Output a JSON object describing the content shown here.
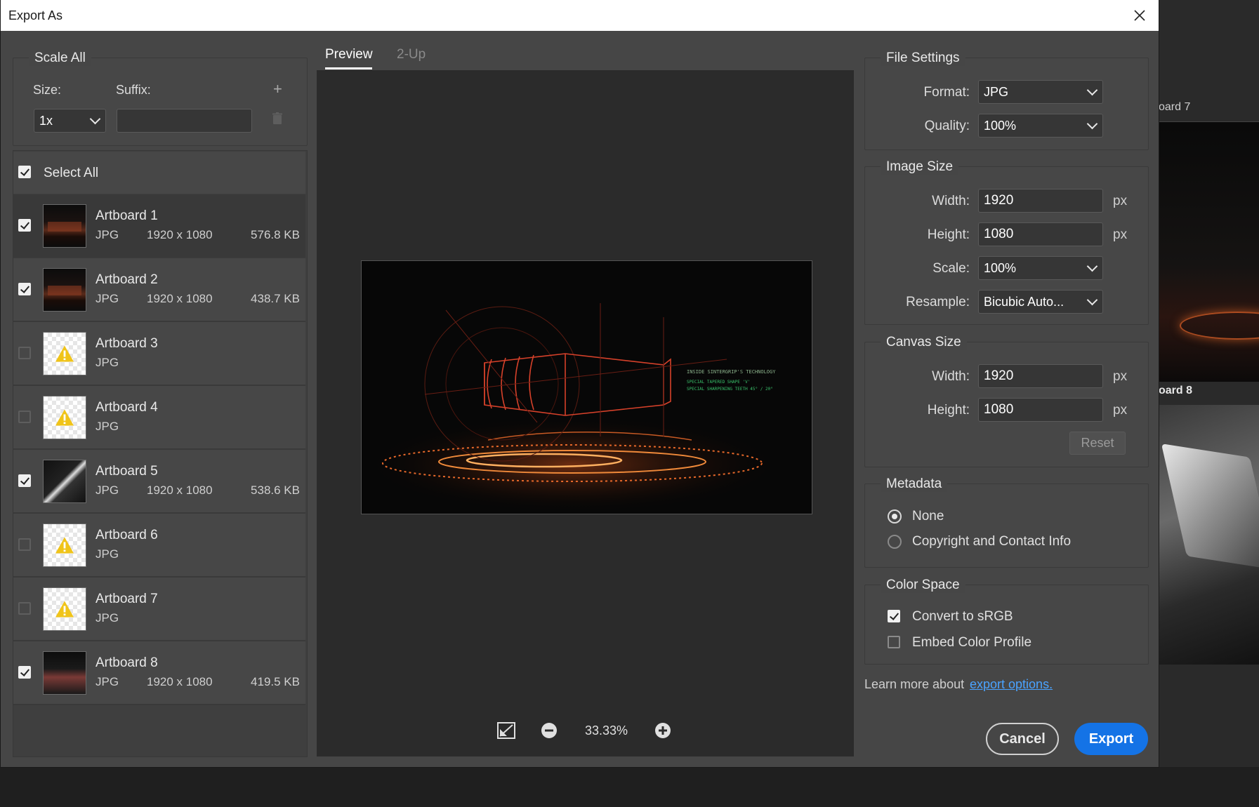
{
  "dialog": {
    "title": "Export As"
  },
  "scale_all": {
    "legend": "Scale All",
    "size_label": "Size:",
    "suffix_label": "Suffix:",
    "size_value": "1x",
    "suffix_value": ""
  },
  "artboards": {
    "select_all_label": "Select All",
    "items": [
      {
        "name": "Artboard 1",
        "format": "JPG",
        "dims": "1920 x 1080",
        "size": "576.8 KB",
        "checked": true,
        "warning": false
      },
      {
        "name": "Artboard 2",
        "format": "JPG",
        "dims": "1920 x 1080",
        "size": "438.7 KB",
        "checked": true,
        "warning": false
      },
      {
        "name": "Artboard 3",
        "format": "JPG",
        "dims": "",
        "size": "",
        "checked": false,
        "warning": true
      },
      {
        "name": "Artboard 4",
        "format": "JPG",
        "dims": "",
        "size": "",
        "checked": false,
        "warning": true
      },
      {
        "name": "Artboard 5",
        "format": "JPG",
        "dims": "1920 x 1080",
        "size": "538.6 KB",
        "checked": true,
        "warning": false
      },
      {
        "name": "Artboard 6",
        "format": "JPG",
        "dims": "",
        "size": "",
        "checked": false,
        "warning": true
      },
      {
        "name": "Artboard 7",
        "format": "JPG",
        "dims": "",
        "size": "",
        "checked": false,
        "warning": true
      },
      {
        "name": "Artboard 8",
        "format": "JPG",
        "dims": "1920 x 1080",
        "size": "419.5 KB",
        "checked": true,
        "warning": false
      }
    ]
  },
  "preview": {
    "tab_preview": "Preview",
    "tab_2up": "2-Up",
    "zoom": "33.33%",
    "overlay_line1": "INSIDE SINTERGRIP'S TECHNOLOGY",
    "overlay_line2": "SPECIAL TAPERED SHAPE 'V'",
    "overlay_line3": "SPECIAL SHARPENING TEETH 45° / 20°"
  },
  "file_settings": {
    "legend": "File Settings",
    "format_label": "Format:",
    "format_value": "JPG",
    "quality_label": "Quality:",
    "quality_value": "100%"
  },
  "image_size": {
    "legend": "Image Size",
    "width_label": "Width:",
    "width_value": "1920",
    "height_label": "Height:",
    "height_value": "1080",
    "scale_label": "Scale:",
    "scale_value": "100%",
    "resample_label": "Resample:",
    "resample_value": "Bicubic Auto...",
    "unit": "px"
  },
  "canvas_size": {
    "legend": "Canvas Size",
    "width_label": "Width:",
    "width_value": "1920",
    "height_label": "Height:",
    "height_value": "1080",
    "unit": "px",
    "reset_label": "Reset"
  },
  "metadata": {
    "legend": "Metadata",
    "option_none": "None",
    "option_copyright": "Copyright and Contact Info",
    "selected": "None"
  },
  "color_space": {
    "legend": "Color Space",
    "convert_label": "Convert to sRGB",
    "convert_checked": true,
    "embed_label": "Embed Color Profile",
    "embed_checked": false
  },
  "footer": {
    "learn_more": "Learn more about",
    "link_text": "export options.",
    "cancel_label": "Cancel",
    "export_label": "Export"
  },
  "background": {
    "artboard7_label": "oard 7",
    "artboard8_label": "oard 8"
  },
  "colors": {
    "accent": "#1473e6",
    "link": "#4aa3ff",
    "dialog_bg": "#464646",
    "preview_bg": "#2b2b2b"
  }
}
